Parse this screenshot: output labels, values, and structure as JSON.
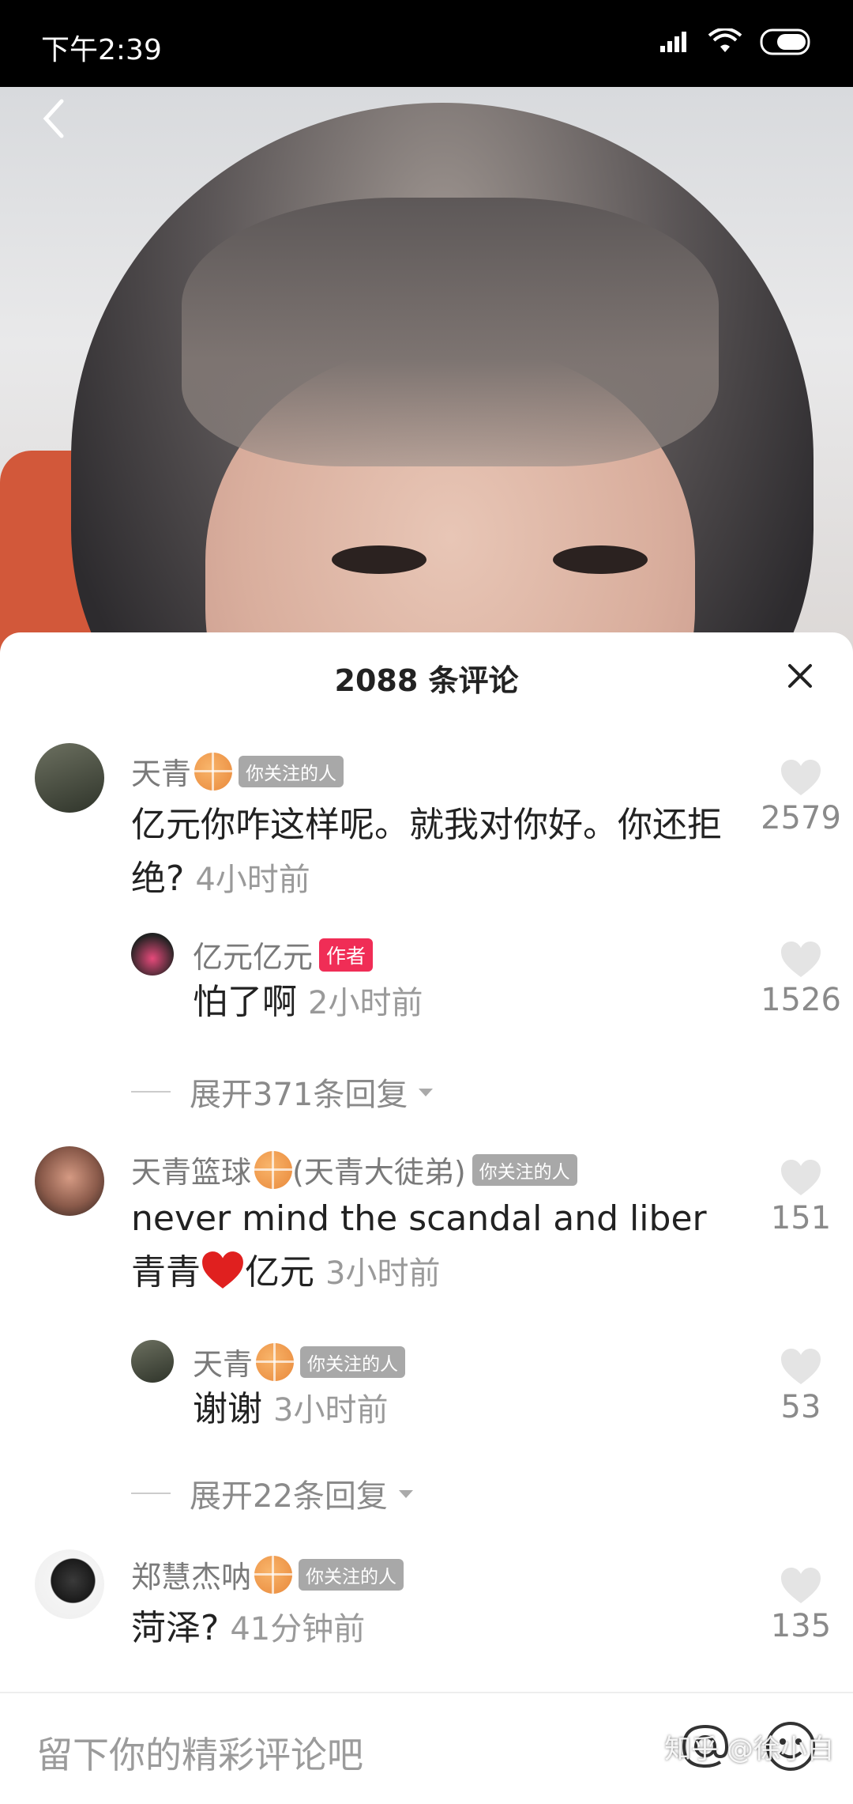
{
  "status_bar": {
    "time": "下午2:39"
  },
  "comments_sheet": {
    "title": "2088 条评论",
    "comments": [
      {
        "user": "天青",
        "badge": "你关注的人",
        "text": "亿元你咋这样呢。就我对你好。你还拒绝?",
        "time": "4小时前",
        "likes": "2579"
      },
      {
        "user": "亿元亿元",
        "badge": "作者",
        "text": "怕了啊",
        "time": "2小时前",
        "likes": "1526",
        "is_reply": true
      },
      {
        "expand": "展开371条回复"
      },
      {
        "user": "天青篮球",
        "user_suffix": "(天青大徒弟)",
        "badge": "你关注的人",
        "text_line1": "never mind the scandal and liber",
        "text_line2a": "青青",
        "text_line2b": "亿元",
        "time": "3小时前",
        "likes": "151"
      },
      {
        "user": "天青",
        "badge": "你关注的人",
        "text": "谢谢",
        "time": "3小时前",
        "likes": "53",
        "is_reply": true
      },
      {
        "expand": "展开22条回复"
      },
      {
        "user": "郑慧杰呐",
        "badge": "你关注的人",
        "text": "菏泽?",
        "time": "41分钟前",
        "likes": "135"
      }
    ]
  },
  "input": {
    "placeholder": "留下你的精彩评论吧"
  },
  "watermark": "知乎 @徐小白",
  "colors": {
    "author_badge": "#f02d56",
    "follow_badge": "#a8a8a8",
    "heart": "#e4e4e4"
  }
}
